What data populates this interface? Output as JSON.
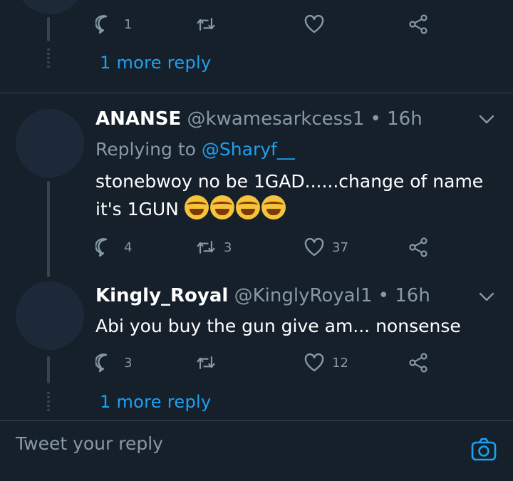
{
  "top_thread": {
    "actions": {
      "reply_count": "1",
      "retweet_count": "",
      "like_count": ""
    },
    "more_replies": "1 more reply"
  },
  "reply1": {
    "name": "ANANSE",
    "handle": "@kwamesarkcess1",
    "separator": "•",
    "time": "16h",
    "replying_prefix": "Replying to",
    "replying_to": "@Sharyf__",
    "text_line1": "stonebwoy  no be 1GAD......change of name",
    "text_line2": "it's 1GUN",
    "emoji": "face-with-tears-of-joy x4",
    "actions": {
      "reply_count": "4",
      "retweet_count": "3",
      "like_count": "37"
    }
  },
  "reply2": {
    "name": "Kingly_Royal",
    "handle": "@KinglyRoyal1",
    "separator": "•",
    "time": "16h",
    "text": "Abi you buy the gun give am... nonsense",
    "actions": {
      "reply_count": "3",
      "retweet_count": "",
      "like_count": "12"
    },
    "more_replies": "1 more reply"
  },
  "compose": {
    "placeholder": "Tweet your reply"
  },
  "colors": {
    "background": "#15202b",
    "accent": "#1da1f2",
    "muted": "#8899a6",
    "line": "#38444d"
  }
}
